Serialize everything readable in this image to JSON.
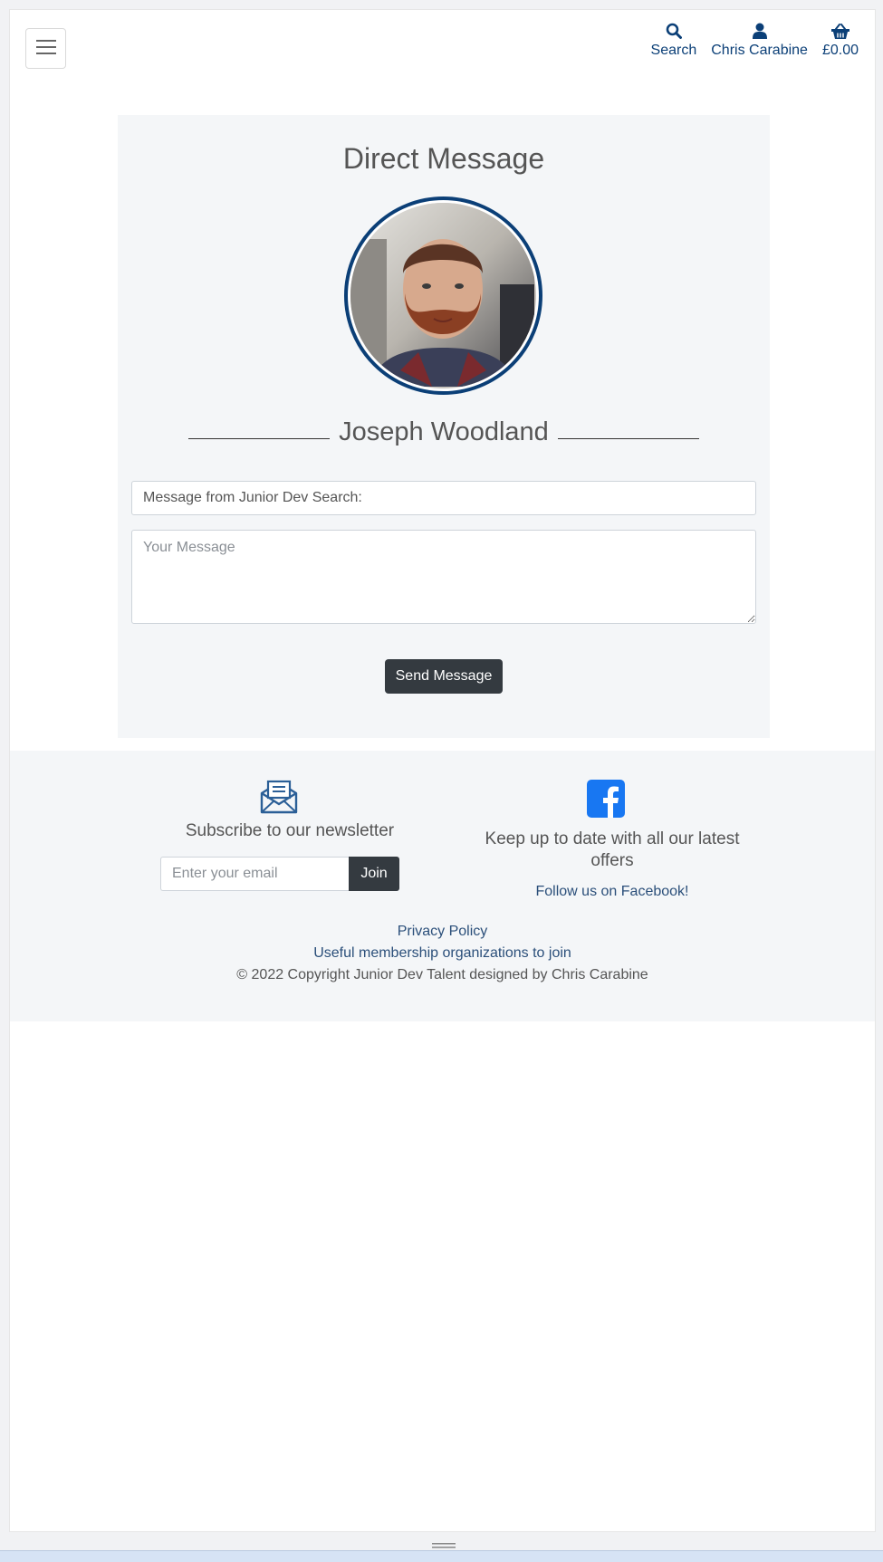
{
  "header": {
    "menu_label": "Menu",
    "nav": [
      {
        "label": "Search",
        "icon": "search-icon"
      },
      {
        "label": "Chris Carabine",
        "icon": "user-icon"
      },
      {
        "label": "£0.00",
        "icon": "basket-icon"
      }
    ]
  },
  "card": {
    "title": "Direct Message",
    "profile_name": "Joseph Woodland",
    "subject_value": "Message from Junior Dev Search:",
    "message_placeholder": "Your Message",
    "send_label": "Send Message"
  },
  "footer": {
    "newsletter_title": "Subscribe to our newsletter",
    "email_placeholder": "Enter your email",
    "join_label": "Join",
    "offers_text": "Keep up to date with all our latest offers",
    "facebook_link": "Follow us on Facebook!",
    "privacy_link": "Privacy Policy",
    "membership_link": "Useful membership organizations to join",
    "copyright": "© 2022 Copyright Junior Dev Talent designed by Chris Carabine"
  },
  "colors": {
    "brand_blue": "#0b3f77",
    "dark_button": "#343a40",
    "facebook_blue": "#1877f2",
    "panel_bg": "#f4f6f8"
  }
}
